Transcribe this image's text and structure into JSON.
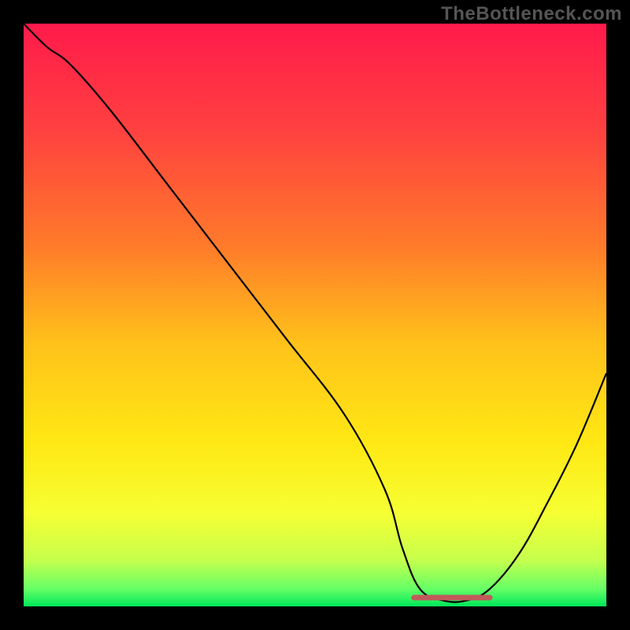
{
  "watermark": "TheBottleneck.com",
  "chart_data": {
    "type": "line",
    "title": "",
    "xlabel": "",
    "ylabel": "",
    "xlim": [
      0,
      100
    ],
    "ylim": [
      0,
      100
    ],
    "series": [
      {
        "name": "bottleneck-curve",
        "x": [
          0,
          4,
          8,
          15,
          25,
          35,
          45,
          55,
          62,
          65,
          68,
          72,
          76,
          80,
          85,
          90,
          95,
          100
        ],
        "y": [
          100,
          96,
          93,
          85,
          72,
          59,
          46,
          33,
          20,
          10,
          3,
          1,
          1,
          3,
          9,
          18,
          28,
          40
        ]
      },
      {
        "name": "optimal-flat-segment",
        "x": [
          67,
          80
        ],
        "y": [
          1.5,
          1.5
        ]
      }
    ],
    "gradient_stops": [
      {
        "pos": 0.0,
        "color": "#ff1a4b"
      },
      {
        "pos": 0.18,
        "color": "#ff4040"
      },
      {
        "pos": 0.38,
        "color": "#ff7a2a"
      },
      {
        "pos": 0.55,
        "color": "#ffc21a"
      },
      {
        "pos": 0.72,
        "color": "#ffe814"
      },
      {
        "pos": 0.84,
        "color": "#f6ff33"
      },
      {
        "pos": 0.92,
        "color": "#c6ff4d"
      },
      {
        "pos": 0.97,
        "color": "#66ff66"
      },
      {
        "pos": 1.0,
        "color": "#00e85a"
      }
    ],
    "flat_segment_color": "#c15a5a"
  }
}
